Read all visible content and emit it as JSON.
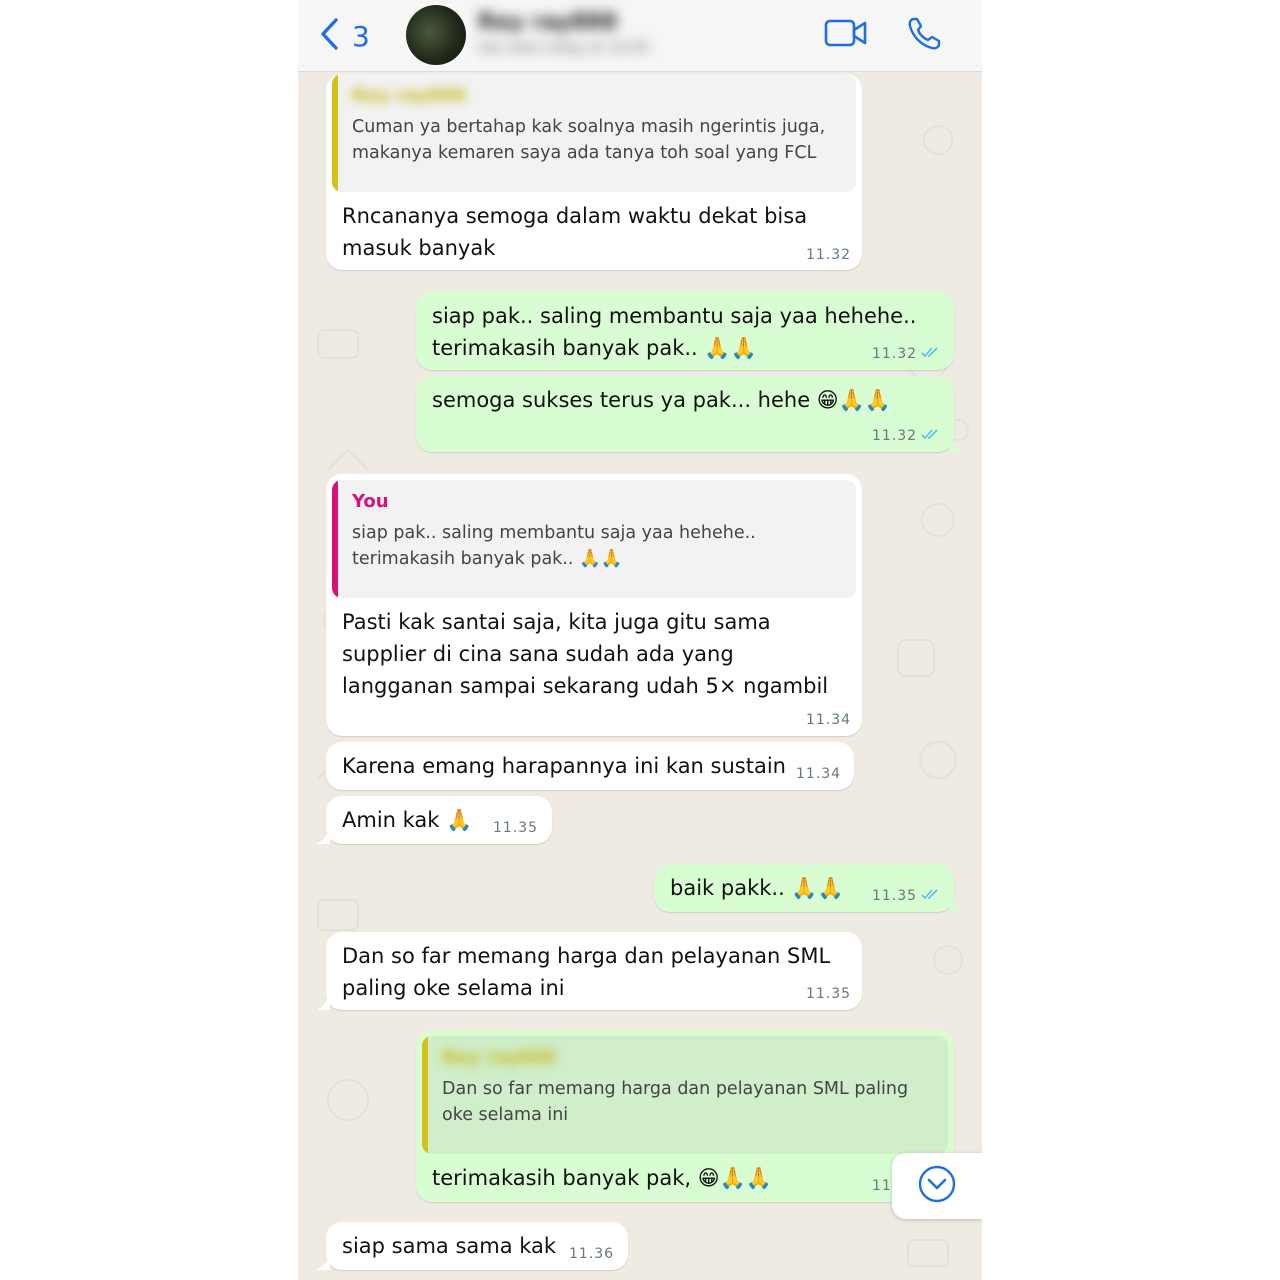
{
  "header": {
    "back_count": "3",
    "contact_name": "Rey ray888",
    "contact_status": "last seen today at 10.00"
  },
  "messages": [
    {
      "direction": "in",
      "quote": {
        "author": "Rey ray888",
        "text": "Cuman ya bertahap kak soalnya masih ngerintis juga,\nmakanya kemaren saya ada tanya toh soal yang FCL"
      },
      "text": "Rncananya semoga dalam waktu dekat bisa\nmasuk banyak",
      "time": "11.32"
    },
    {
      "direction": "out",
      "text": "siap pak.. saling membantu saja yaa hehehe..\nterimakasih banyak pak.. 🙏🙏",
      "time": "11.32",
      "status": "read"
    },
    {
      "direction": "out",
      "text": "semoga sukses terus ya pak... hehe 😁🙏🙏",
      "time": "11.32",
      "status": "read"
    },
    {
      "direction": "in",
      "quote": {
        "author": "You",
        "text": "siap pak.. saling membantu saja yaa hehehe..\nterimakasih banyak pak.. 🙏🙏"
      },
      "text": "Pasti kak santai saja, kita juga gitu sama\nsupplier di cina sana sudah ada yang\nlangganan sampai sekarang udah 5× ngambil",
      "time": "11.34"
    },
    {
      "direction": "in",
      "text": "Karena emang harapannya ini kan sustain",
      "time": "11.34"
    },
    {
      "direction": "in",
      "text": "Amin kak 🙏",
      "time": "11.35"
    },
    {
      "direction": "out",
      "text": "baik pakk.. 🙏🙏",
      "time": "11.35",
      "status": "read"
    },
    {
      "direction": "in",
      "text": "Dan so far memang harga dan pelayanan SML\npaling oke selama ini",
      "time": "11.35"
    },
    {
      "direction": "out",
      "quote": {
        "author": "Rey ray888",
        "text": "Dan so far memang harga dan pelayanan SML paling\noke selama ini"
      },
      "text": "terimakasih banyak pak, 😁🙏🙏",
      "time": "11"
    },
    {
      "direction": "in",
      "text": "siap sama sama kak",
      "time": "11.36"
    }
  ],
  "colors": {
    "accent": "#1f6fe0",
    "incoming_bubble": "#ffffff",
    "outgoing_bubble": "#d9fdd3",
    "quote_bar_contact": "#d4c21a",
    "quote_bar_you": "#d6127a",
    "quote_bar_outgoing": "#d4c21a",
    "read_ticks": "#53bdeb",
    "chat_background": "#efeae2"
  },
  "icons": {
    "back": "chevron-left-icon",
    "video": "video-camera-icon",
    "call": "phone-icon",
    "scroll": "chevron-down-circle-icon",
    "read": "double-check-icon"
  }
}
